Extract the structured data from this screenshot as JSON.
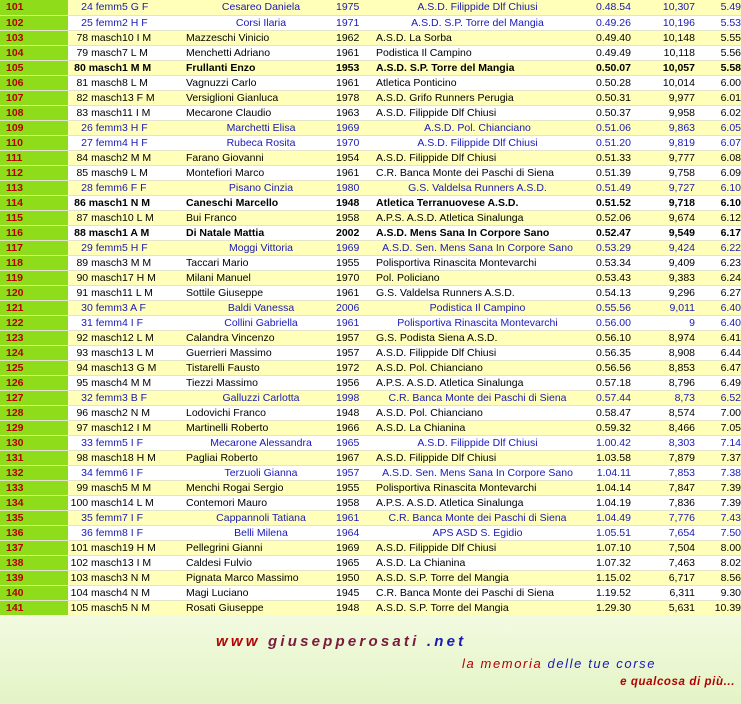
{
  "rows": [
    {
      "num": "101",
      "pos": "24 femm",
      "cat": "5 G F",
      "name": "Cesareo Daniela",
      "year": "1975",
      "team": "A.S.D. Filippide Dlf Chiusi",
      "time": "0.48.54",
      "pts": "10,307",
      "pace": "5.49",
      "f": true,
      "b": false
    },
    {
      "num": "102",
      "pos": "25 femm",
      "cat": "2 H F",
      "name": "Corsi Ilaria",
      "year": "1971",
      "team": "A.S.D. S.P. Torre del Mangia",
      "time": "0.49.26",
      "pts": "10,196",
      "pace": "5.53",
      "f": true,
      "b": false
    },
    {
      "num": "103",
      "pos": "78 masch",
      "cat": "10 I M",
      "name": "Mazzeschi Vinicio",
      "year": "1962",
      "team": "A.S.D. La Sorba",
      "time": "0.49.40",
      "pts": "10,148",
      "pace": "5.55",
      "f": false,
      "b": false
    },
    {
      "num": "104",
      "pos": "79 masch",
      "cat": "7 L M",
      "name": "Menchetti Adriano",
      "year": "1961",
      "team": "Podistica Il Campino",
      "time": "0.49.49",
      "pts": "10,118",
      "pace": "5.56",
      "f": false,
      "b": false
    },
    {
      "num": "105",
      "pos": "80 masch",
      "cat": "1 M M",
      "name": "Frullanti Enzo",
      "year": "1953",
      "team": "A.S.D. S.P. Torre del Mangia",
      "time": "0.50.07",
      "pts": "10,057",
      "pace": "5.58",
      "f": false,
      "b": true
    },
    {
      "num": "106",
      "pos": "81 masch",
      "cat": "8 L M",
      "name": "Vagnuzzi Carlo",
      "year": "1961",
      "team": "Atletica Ponticino",
      "time": "0.50.28",
      "pts": "10,014",
      "pace": "6.00",
      "f": false,
      "b": false
    },
    {
      "num": "107",
      "pos": "82 masch",
      "cat": "13 F M",
      "name": "Versiglioni Gianluca",
      "year": "1978",
      "team": "A.S.D. Grifo Runners Perugia",
      "time": "0.50.31",
      "pts": "9,977",
      "pace": "6.01",
      "f": false,
      "b": false
    },
    {
      "num": "108",
      "pos": "83 masch",
      "cat": "11 I M",
      "name": "Mecarone Claudio",
      "year": "1963",
      "team": "A.S.D. Filippide Dlf Chiusi",
      "time": "0.50.37",
      "pts": "9,958",
      "pace": "6.02",
      "f": false,
      "b": false
    },
    {
      "num": "109",
      "pos": "26 femm",
      "cat": "3 H F",
      "name": "Marchetti Elisa",
      "year": "1969",
      "team": "A.S.D. Pol. Chianciano",
      "time": "0.51.06",
      "pts": "9,863",
      "pace": "6.05",
      "f": true,
      "b": false
    },
    {
      "num": "110",
      "pos": "27 femm",
      "cat": "4 H F",
      "name": "Rubeca Rosita",
      "year": "1970",
      "team": "A.S.D. Filippide Dlf Chiusi",
      "time": "0.51.20",
      "pts": "9,819",
      "pace": "6.07",
      "f": true,
      "b": false
    },
    {
      "num": "111",
      "pos": "84 masch",
      "cat": "2 M M",
      "name": "Farano Giovanni",
      "year": "1954",
      "team": "A.S.D. Filippide Dlf Chiusi",
      "time": "0.51.33",
      "pts": "9,777",
      "pace": "6.08",
      "f": false,
      "b": false
    },
    {
      "num": "112",
      "pos": "85 masch",
      "cat": "9 L M",
      "name": "Montefiori Marco",
      "year": "1961",
      "team": "C.R. Banca Monte dei Paschi di Siena",
      "time": "0.51.39",
      "pts": "9,758",
      "pace": "6.09",
      "f": false,
      "b": false
    },
    {
      "num": "113",
      "pos": "28 femm",
      "cat": "6 F F",
      "name": "Pisano Cinzia",
      "year": "1980",
      "team": "G.S. Valdelsa Runners A.S.D.",
      "time": "0.51.49",
      "pts": "9,727",
      "pace": "6.10",
      "f": true,
      "b": false
    },
    {
      "num": "114",
      "pos": "86 masch",
      "cat": "1 N M",
      "name": "Caneschi Marcello",
      "year": "1948",
      "team": "Atletica Terranuovese A.S.D.",
      "time": "0.51.52",
      "pts": "9,718",
      "pace": "6.10",
      "f": false,
      "b": true
    },
    {
      "num": "115",
      "pos": "87 masch",
      "cat": "10 L M",
      "name": "Bui Franco",
      "year": "1958",
      "team": "A.P.S. A.S.D. Atletica Sinalunga",
      "time": "0.52.06",
      "pts": "9,674",
      "pace": "6.12",
      "f": false,
      "b": false
    },
    {
      "num": "116",
      "pos": "88 masch",
      "cat": "1 A M",
      "name": "Di Natale Mattia",
      "year": "2002",
      "team": "A.S.D. Mens Sana In Corpore Sano",
      "time": "0.52.47",
      "pts": "9,549",
      "pace": "6.17",
      "f": false,
      "b": true
    },
    {
      "num": "117",
      "pos": "29 femm",
      "cat": "5 H F",
      "name": "Moggi Vittoria",
      "year": "1969",
      "team": "A.S.D. Sen. Mens Sana In Corpore Sano",
      "time": "0.53.29",
      "pts": "9,424",
      "pace": "6.22",
      "f": true,
      "b": false
    },
    {
      "num": "118",
      "pos": "89 masch",
      "cat": "3 M M",
      "name": "Taccari Mario",
      "year": "1955",
      "team": "Polisportiva Rinascita Montevarchi",
      "time": "0.53.34",
      "pts": "9,409",
      "pace": "6.23",
      "f": false,
      "b": false
    },
    {
      "num": "119",
      "pos": "90 masch",
      "cat": "17 H M",
      "name": "Milani Manuel",
      "year": "1970",
      "team": "Pol. Policiano",
      "time": "0.53.43",
      "pts": "9,383",
      "pace": "6.24",
      "f": false,
      "b": false
    },
    {
      "num": "120",
      "pos": "91 masch",
      "cat": "11 L M",
      "name": "Sottile Giuseppe",
      "year": "1961",
      "team": "G.S. Valdelsa Runners A.S.D.",
      "time": "0.54.13",
      "pts": "9,296",
      "pace": "6.27",
      "f": false,
      "b": false
    },
    {
      "num": "121",
      "pos": "30 femm",
      "cat": "3 A F",
      "name": "Baldi Vanessa",
      "year": "2006",
      "team": "Podistica Il Campino",
      "time": "0.55.56",
      "pts": "9,011",
      "pace": "6.40",
      "f": true,
      "b": false
    },
    {
      "num": "122",
      "pos": "31 femm",
      "cat": "4 I F",
      "name": "Collini Gabriella",
      "year": "1961",
      "team": "Polisportiva Rinascita Montevarchi",
      "time": "0.56.00",
      "pts": "9",
      "pace": "6.40",
      "f": true,
      "b": false
    },
    {
      "num": "123",
      "pos": "92 masch",
      "cat": "12 L M",
      "name": "Calandra Vincenzo",
      "year": "1957",
      "team": "G.S. Podista Siena A.S.D.",
      "time": "0.56.10",
      "pts": "8,974",
      "pace": "6.41",
      "f": false,
      "b": false
    },
    {
      "num": "124",
      "pos": "93 masch",
      "cat": "13 L M",
      "name": "Guerrieri Massimo",
      "year": "1957",
      "team": "A.S.D. Filippide Dlf Chiusi",
      "time": "0.56.35",
      "pts": "8,908",
      "pace": "6.44",
      "f": false,
      "b": false
    },
    {
      "num": "125",
      "pos": "94 masch",
      "cat": "13 G M",
      "name": "Tistarelli Fausto",
      "year": "1972",
      "team": "A.S.D. Pol. Chianciano",
      "time": "0.56.56",
      "pts": "8,853",
      "pace": "6.47",
      "f": false,
      "b": false
    },
    {
      "num": "126",
      "pos": "95 masch",
      "cat": "4 M M",
      "name": "Tiezzi Massimo",
      "year": "1956",
      "team": "A.P.S. A.S.D. Atletica Sinalunga",
      "time": "0.57.18",
      "pts": "8,796",
      "pace": "6.49",
      "f": false,
      "b": false
    },
    {
      "num": "127",
      "pos": "32 femm",
      "cat": "3 B F",
      "name": "Galluzzi Carlotta",
      "year": "1998",
      "team": "C.R. Banca Monte dei Paschi di Siena",
      "time": "0.57.44",
      "pts": "8,73",
      "pace": "6.52",
      "f": true,
      "b": false
    },
    {
      "num": "128",
      "pos": "96 masch",
      "cat": "2 N M",
      "name": "Lodovichi Franco",
      "year": "1948",
      "team": "A.S.D. Pol. Chianciano",
      "time": "0.58.47",
      "pts": "8,574",
      "pace": "7.00",
      "f": false,
      "b": false
    },
    {
      "num": "129",
      "pos": "97 masch",
      "cat": "12 I M",
      "name": "Martinelli Roberto",
      "year": "1966",
      "team": "A.S.D. La Chianina",
      "time": "0.59.32",
      "pts": "8,466",
      "pace": "7.05",
      "f": false,
      "b": false
    },
    {
      "num": "130",
      "pos": "33 femm",
      "cat": "5 I F",
      "name": "Mecarone Alessandra",
      "year": "1965",
      "team": "A.S.D. Filippide Dlf Chiusi",
      "time": "1.00.42",
      "pts": "8,303",
      "pace": "7.14",
      "f": true,
      "b": false
    },
    {
      "num": "131",
      "pos": "98 masch",
      "cat": "18 H M",
      "name": "Pagliai Roberto",
      "year": "1967",
      "team": "A.S.D. Filippide Dlf Chiusi",
      "time": "1.03.58",
      "pts": "7,879",
      "pace": "7.37",
      "f": false,
      "b": false
    },
    {
      "num": "132",
      "pos": "34 femm",
      "cat": "6 I F",
      "name": "Terzuoli Gianna",
      "year": "1957",
      "team": "A.S.D. Sen. Mens Sana In Corpore Sano",
      "time": "1.04.11",
      "pts": "7,853",
      "pace": "7.38",
      "f": true,
      "b": false
    },
    {
      "num": "133",
      "pos": "99 masch",
      "cat": "5 M M",
      "name": "Menchi Rogai Sergio",
      "year": "1955",
      "team": "Polisportiva Rinascita Montevarchi",
      "time": "1.04.14",
      "pts": "7,847",
      "pace": "7.39",
      "f": false,
      "b": false
    },
    {
      "num": "134",
      "pos": "100 masch",
      "cat": "14 L M",
      "name": "Contemori Mauro",
      "year": "1958",
      "team": "A.P.S. A.S.D. Atletica Sinalunga",
      "time": "1.04.19",
      "pts": "7,836",
      "pace": "7.39",
      "f": false,
      "b": false
    },
    {
      "num": "135",
      "pos": "35 femm",
      "cat": "7 I F",
      "name": "Cappannoli Tatiana",
      "year": "1961",
      "team": "C.R. Banca Monte dei Paschi di Siena",
      "time": "1.04.49",
      "pts": "7,776",
      "pace": "7.43",
      "f": true,
      "b": false
    },
    {
      "num": "136",
      "pos": "36 femm",
      "cat": "8 I F",
      "name": "Belli Milena",
      "year": "1964",
      "team": "APS ASD S. Egidio",
      "time": "1.05.51",
      "pts": "7,654",
      "pace": "7.50",
      "f": true,
      "b": false
    },
    {
      "num": "137",
      "pos": "101 masch",
      "cat": "19 H M",
      "name": "Pellegrini Gianni",
      "year": "1969",
      "team": "A.S.D. Filippide Dlf Chiusi",
      "time": "1.07.10",
      "pts": "7,504",
      "pace": "8.00",
      "f": false,
      "b": false
    },
    {
      "num": "138",
      "pos": "102 masch",
      "cat": "13 I M",
      "name": "Caldesi Fulvio",
      "year": "1965",
      "team": "A.S.D. La Chianina",
      "time": "1.07.32",
      "pts": "7,463",
      "pace": "8.02",
      "f": false,
      "b": false
    },
    {
      "num": "139",
      "pos": "103 masch",
      "cat": "3 N M",
      "name": "Pignata Marco Massimo",
      "year": "1950",
      "team": "A.S.D. S.P. Torre del Mangia",
      "time": "1.15.02",
      "pts": "6,717",
      "pace": "8.56",
      "f": false,
      "b": false
    },
    {
      "num": "140",
      "pos": "104 masch",
      "cat": "4 N M",
      "name": "Magi Luciano",
      "year": "1945",
      "team": "C.R. Banca Monte dei Paschi di Siena",
      "time": "1.19.52",
      "pts": "6,311",
      "pace": "9.30",
      "f": false,
      "b": false
    },
    {
      "num": "141",
      "pos": "105 masch",
      "cat": "5 N M",
      "name": "Rosati Giuseppe",
      "year": "1948",
      "team": "A.S.D. S.P. Torre del Mangia",
      "time": "1.29.30",
      "pts": "5,631",
      "pace": "10.39",
      "f": false,
      "b": false
    }
  ],
  "footer": {
    "site_www": "www",
    "site_domain": "giusepperosati",
    "site_tld": ".net",
    "tagline_a": "la memoria",
    "tagline_b": "delle tue corse",
    "tagline2": "e qualcosa di più..."
  }
}
